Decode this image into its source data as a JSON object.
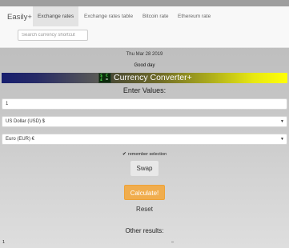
{
  "navbar": {
    "brand": "Easily+",
    "tabs": [
      {
        "label": "Exchange rates",
        "active": true
      },
      {
        "label": "Exchange rates table",
        "active": false
      },
      {
        "label": "Bitcoin rate",
        "active": false
      },
      {
        "label": "Ethereum rate",
        "active": false
      }
    ],
    "search_placeholder": "Search currency shortcut"
  },
  "date": "Thu Mar 28 2019",
  "greeting": "Good day",
  "banner": {
    "title": "Currency Converter+",
    "logo_chars": [
      "$",
      "€",
      "£",
      "="
    ]
  },
  "form": {
    "heading": "Enter Values:",
    "amount": "1",
    "from_currency": "US Dollar (USD) $",
    "to_currency": "Euro (EUR) €",
    "remember_label": "remember selection",
    "remember_checked": true,
    "swap_label": "Swap",
    "calculate_label": "Calculate!",
    "reset_label": "Reset"
  },
  "results": {
    "heading": "Other results:",
    "first_row_left": "1",
    "first_row_right": "–"
  },
  "colors": {
    "calculate_button": "#f0ad4e",
    "banner_left": "#171e6e",
    "banner_right": "#ffff06"
  }
}
